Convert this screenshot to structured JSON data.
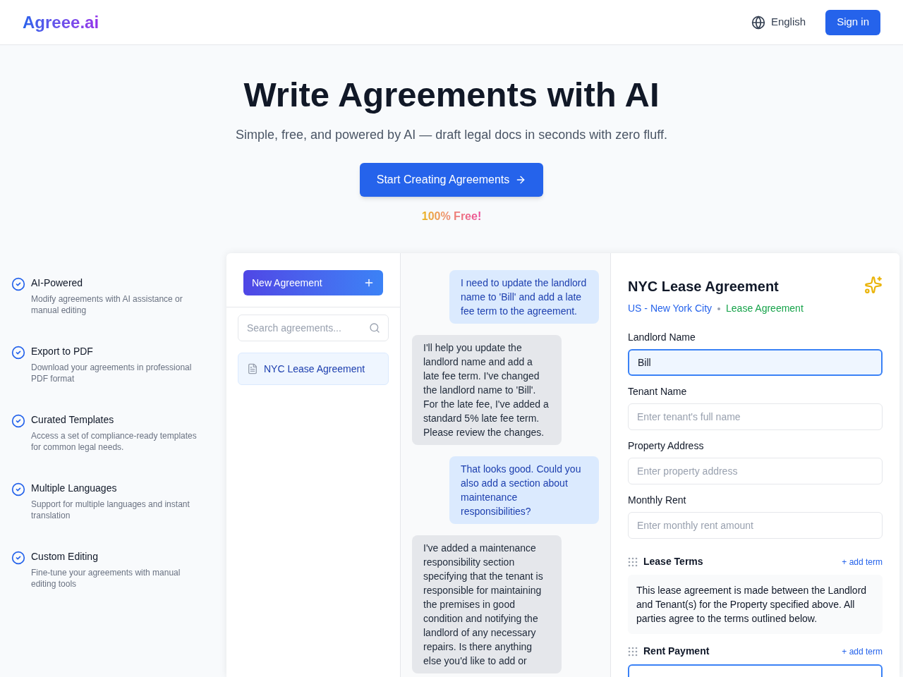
{
  "header": {
    "logo": "Agreee.ai",
    "language": "English",
    "sign_in": "Sign in"
  },
  "hero": {
    "title": "Write Agreements with AI",
    "subtitle": "Simple, free, and powered by AI — draft legal docs in seconds with zero fluff.",
    "cta": "Start Creating Agreements",
    "free_note": "100% Free!"
  },
  "features": [
    {
      "title": "AI-Powered",
      "description": "Modify agreements with AI assistance or manual editing"
    },
    {
      "title": "Export to PDF",
      "description": "Download your agreements in professional PDF format"
    },
    {
      "title": "Curated Templates",
      "description": "Access a set of compliance-ready templates for common legal needs."
    },
    {
      "title": "Multiple Languages",
      "description": "Support for multiple languages and instant translation"
    },
    {
      "title": "Custom Editing",
      "description": "Fine-tune your agreements with manual editing tools"
    }
  ],
  "sidebar": {
    "new_button": "New Agreement",
    "search": {
      "placeholder": "Search agreements..."
    },
    "items": [
      {
        "label": "NYC Lease Agreement",
        "selected": true
      }
    ]
  },
  "chat": {
    "messages": [
      {
        "kind": "user",
        "text": "I need to update the landlord name to 'Bill' and add a late fee term to the agreement."
      },
      {
        "kind": "assistant",
        "text": "I'll help you update the landlord name and add a late fee term. I've changed the landlord name to 'Bill'. For the late fee, I've added a standard 5% late fee term. Please review the changes."
      },
      {
        "kind": "user",
        "text": "That looks good. Could you also add a section about maintenance responsibilities?"
      },
      {
        "kind": "assistant",
        "text": "I've added a maintenance responsibility section specifying that the tenant is responsible for maintaining the premises in good condition and notifying the landlord of any necessary repairs. Is there anything else you'd like to add or"
      }
    ]
  },
  "document": {
    "title": "NYC Lease Agreement",
    "jurisdiction": "US - New York City",
    "type": "Lease Agreement",
    "fields": [
      {
        "label": "Landlord Name",
        "value": "Bill",
        "highlighted": true
      },
      {
        "label": "Tenant Name",
        "placeholder": "Enter tenant's full name",
        "highlighted": false
      },
      {
        "label": "Property Address",
        "placeholder": "Enter property address",
        "highlighted": false
      },
      {
        "label": "Monthly Rent",
        "placeholder": "Enter monthly rent amount",
        "highlighted": false
      }
    ],
    "sections": [
      {
        "title": "Lease Terms",
        "add_link": "+ add term",
        "body": "This lease agreement is made between the Landlord and Tenant(s) for the Property specified above. All parties agree to the terms outlined below.",
        "highlighted": false
      },
      {
        "title": "Rent Payment",
        "add_link": "+ add term",
        "highlighted": true
      }
    ]
  }
}
